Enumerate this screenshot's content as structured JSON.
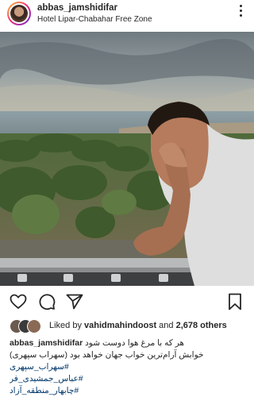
{
  "post": {
    "username": "abbas_jamshidifar",
    "location": "Hotel Lipar-Chabahar Free Zone"
  },
  "likes": {
    "prefix": "Liked by",
    "user": "vahidmahindoost",
    "and": "and",
    "count": "2,678 others"
  },
  "caption": {
    "username": "abbas_jamshidifar",
    "line1": "هر که با مرغ هوا دوست شود",
    "line2": "خوابش آرام‌ترین خواب جهان خواهد بود (سهراب سپهری)",
    "hashtags": [
      "#سهراب_سپهری",
      "#عباس_جمشیدی_فر",
      "#چابهار_منطقه_آزاد"
    ]
  },
  "icons": {
    "more": "more-vertical-icon",
    "like": "heart-icon",
    "comment": "comment-icon",
    "share": "send-icon",
    "save": "bookmark-icon"
  },
  "colors": {
    "text": "#262626",
    "hashtag": "#00376b"
  }
}
